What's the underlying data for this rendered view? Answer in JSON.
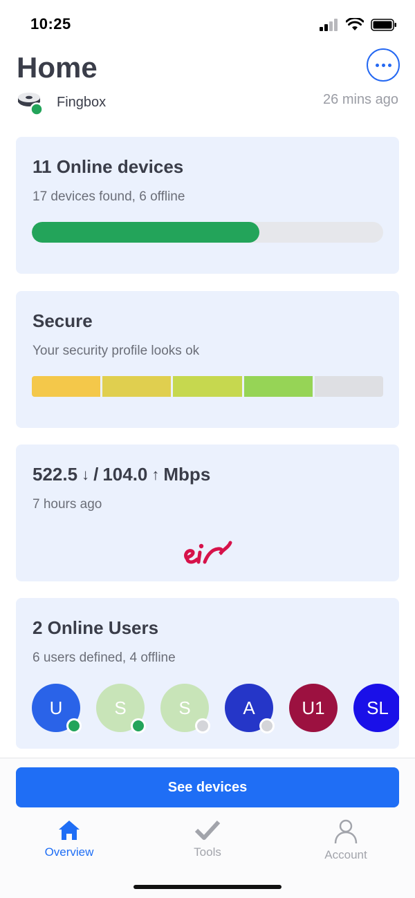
{
  "status_bar": {
    "time": "10:25"
  },
  "header": {
    "title": "Home",
    "device_name": "Fingbox",
    "updated": "26 mins ago"
  },
  "devices_card": {
    "title": "11 Online devices",
    "subtitle": "17 devices found, 6 offline",
    "online_fraction": 0.647,
    "fill_color": "#23a45a"
  },
  "security_card": {
    "title": "Secure",
    "subtitle": "Your security profile looks ok",
    "segment_colors": [
      "#f4c84a",
      "#e0cf4f",
      "#c6d84f",
      "#96d456",
      "#dedfe3"
    ],
    "level": "4 of 5"
  },
  "speed_card": {
    "download": "522.5",
    "upload": "104.0",
    "unit": "Mbps",
    "down_arrow": "↓",
    "up_arrow": "↑",
    "subtitle": "7 hours ago",
    "isp_logo_text": "eir"
  },
  "users_card": {
    "title": "2 Online Users",
    "subtitle": "6 users defined, 4 offline",
    "users": [
      {
        "initials": "U",
        "color": "#2a63e8",
        "status": "online"
      },
      {
        "initials": "S",
        "color": "#c8e4b8",
        "status": "online"
      },
      {
        "initials": "S",
        "color": "#c8e4b8",
        "status": "offline"
      },
      {
        "initials": "A",
        "color": "#2536c8",
        "status": "offline"
      },
      {
        "initials": "U1",
        "color": "#9c1140",
        "status": "none"
      },
      {
        "initials": "SL",
        "color": "#1a10e8",
        "status": "none"
      }
    ]
  },
  "primary_action": {
    "label": "See devices"
  },
  "tabs": [
    {
      "label": "Overview",
      "icon": "home-icon",
      "active": true
    },
    {
      "label": "Tools",
      "icon": "checkmark-icon",
      "active": false
    },
    {
      "label": "Account",
      "icon": "person-icon",
      "active": false
    }
  ],
  "colors": {
    "accent": "#1f6ef5",
    "card_bg": "#ebf1fd",
    "online": "#23a45a",
    "offline": "#d4d5d9",
    "tab_inactive": "#a2a4ab"
  }
}
